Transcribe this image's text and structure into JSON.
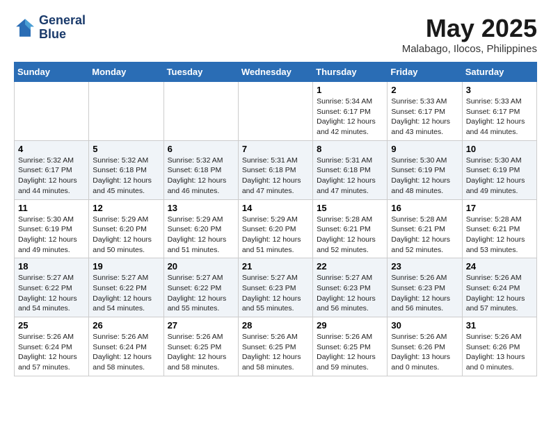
{
  "header": {
    "logo_line1": "General",
    "logo_line2": "Blue",
    "month": "May 2025",
    "location": "Malabago, Ilocos, Philippines"
  },
  "weekdays": [
    "Sunday",
    "Monday",
    "Tuesday",
    "Wednesday",
    "Thursday",
    "Friday",
    "Saturday"
  ],
  "weeks": [
    [
      {
        "day": "",
        "info": ""
      },
      {
        "day": "",
        "info": ""
      },
      {
        "day": "",
        "info": ""
      },
      {
        "day": "",
        "info": ""
      },
      {
        "day": "1",
        "info": "Sunrise: 5:34 AM\nSunset: 6:17 PM\nDaylight: 12 hours\nand 42 minutes."
      },
      {
        "day": "2",
        "info": "Sunrise: 5:33 AM\nSunset: 6:17 PM\nDaylight: 12 hours\nand 43 minutes."
      },
      {
        "day": "3",
        "info": "Sunrise: 5:33 AM\nSunset: 6:17 PM\nDaylight: 12 hours\nand 44 minutes."
      }
    ],
    [
      {
        "day": "4",
        "info": "Sunrise: 5:32 AM\nSunset: 6:17 PM\nDaylight: 12 hours\nand 44 minutes."
      },
      {
        "day": "5",
        "info": "Sunrise: 5:32 AM\nSunset: 6:18 PM\nDaylight: 12 hours\nand 45 minutes."
      },
      {
        "day": "6",
        "info": "Sunrise: 5:32 AM\nSunset: 6:18 PM\nDaylight: 12 hours\nand 46 minutes."
      },
      {
        "day": "7",
        "info": "Sunrise: 5:31 AM\nSunset: 6:18 PM\nDaylight: 12 hours\nand 47 minutes."
      },
      {
        "day": "8",
        "info": "Sunrise: 5:31 AM\nSunset: 6:18 PM\nDaylight: 12 hours\nand 47 minutes."
      },
      {
        "day": "9",
        "info": "Sunrise: 5:30 AM\nSunset: 6:19 PM\nDaylight: 12 hours\nand 48 minutes."
      },
      {
        "day": "10",
        "info": "Sunrise: 5:30 AM\nSunset: 6:19 PM\nDaylight: 12 hours\nand 49 minutes."
      }
    ],
    [
      {
        "day": "11",
        "info": "Sunrise: 5:30 AM\nSunset: 6:19 PM\nDaylight: 12 hours\nand 49 minutes."
      },
      {
        "day": "12",
        "info": "Sunrise: 5:29 AM\nSunset: 6:20 PM\nDaylight: 12 hours\nand 50 minutes."
      },
      {
        "day": "13",
        "info": "Sunrise: 5:29 AM\nSunset: 6:20 PM\nDaylight: 12 hours\nand 51 minutes."
      },
      {
        "day": "14",
        "info": "Sunrise: 5:29 AM\nSunset: 6:20 PM\nDaylight: 12 hours\nand 51 minutes."
      },
      {
        "day": "15",
        "info": "Sunrise: 5:28 AM\nSunset: 6:21 PM\nDaylight: 12 hours\nand 52 minutes."
      },
      {
        "day": "16",
        "info": "Sunrise: 5:28 AM\nSunset: 6:21 PM\nDaylight: 12 hours\nand 52 minutes."
      },
      {
        "day": "17",
        "info": "Sunrise: 5:28 AM\nSunset: 6:21 PM\nDaylight: 12 hours\nand 53 minutes."
      }
    ],
    [
      {
        "day": "18",
        "info": "Sunrise: 5:27 AM\nSunset: 6:22 PM\nDaylight: 12 hours\nand 54 minutes."
      },
      {
        "day": "19",
        "info": "Sunrise: 5:27 AM\nSunset: 6:22 PM\nDaylight: 12 hours\nand 54 minutes."
      },
      {
        "day": "20",
        "info": "Sunrise: 5:27 AM\nSunset: 6:22 PM\nDaylight: 12 hours\nand 55 minutes."
      },
      {
        "day": "21",
        "info": "Sunrise: 5:27 AM\nSunset: 6:23 PM\nDaylight: 12 hours\nand 55 minutes."
      },
      {
        "day": "22",
        "info": "Sunrise: 5:27 AM\nSunset: 6:23 PM\nDaylight: 12 hours\nand 56 minutes."
      },
      {
        "day": "23",
        "info": "Sunrise: 5:26 AM\nSunset: 6:23 PM\nDaylight: 12 hours\nand 56 minutes."
      },
      {
        "day": "24",
        "info": "Sunrise: 5:26 AM\nSunset: 6:24 PM\nDaylight: 12 hours\nand 57 minutes."
      }
    ],
    [
      {
        "day": "25",
        "info": "Sunrise: 5:26 AM\nSunset: 6:24 PM\nDaylight: 12 hours\nand 57 minutes."
      },
      {
        "day": "26",
        "info": "Sunrise: 5:26 AM\nSunset: 6:24 PM\nDaylight: 12 hours\nand 58 minutes."
      },
      {
        "day": "27",
        "info": "Sunrise: 5:26 AM\nSunset: 6:25 PM\nDaylight: 12 hours\nand 58 minutes."
      },
      {
        "day": "28",
        "info": "Sunrise: 5:26 AM\nSunset: 6:25 PM\nDaylight: 12 hours\nand 58 minutes."
      },
      {
        "day": "29",
        "info": "Sunrise: 5:26 AM\nSunset: 6:25 PM\nDaylight: 12 hours\nand 59 minutes."
      },
      {
        "day": "30",
        "info": "Sunrise: 5:26 AM\nSunset: 6:26 PM\nDaylight: 13 hours\nand 0 minutes."
      },
      {
        "day": "31",
        "info": "Sunrise: 5:26 AM\nSunset: 6:26 PM\nDaylight: 13 hours\nand 0 minutes."
      }
    ]
  ]
}
